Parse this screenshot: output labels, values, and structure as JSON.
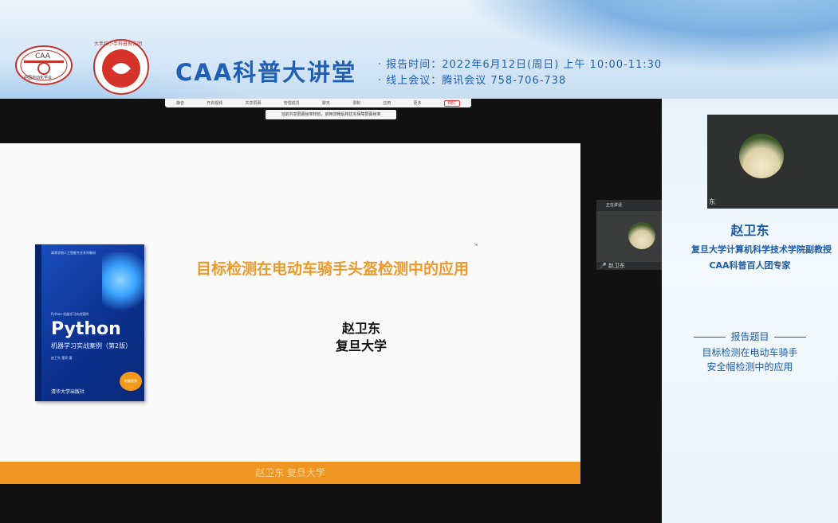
{
  "banner": {
    "brand": "CAA科普大讲堂",
    "time_line": "· 报告时间：2022年6月12日(周日) 上午 10:00-11:30",
    "meeting_line": "· 线上会议：腾讯会议 758-706-738",
    "logo1_text": "CAA",
    "logo1_sub": "中国自动化学会",
    "logo2_text": "大手拉小手科普报告团",
    "accent": "#1f5fb4"
  },
  "toolbar": {
    "items": [
      "静音",
      "开启视频",
      "共享屏幕",
      "管理成员",
      "聊天",
      "录制",
      "应用",
      "更多"
    ],
    "recording": "REC"
  },
  "notice": "当前共享屏幕帧率较低，启用流畅后将优先保障屏幕帧率",
  "slide": {
    "title": "目标检测在电动车骑手头盔检测中的应用",
    "author": "赵卫东",
    "affiliation": "复旦大学",
    "footer": "赵卫东 复旦大学",
    "book_title": "Python",
    "book_subtitle": "机器学习实战案例（第2版）",
    "book_tag": "Python 机器学习实战案例",
    "book_series": "高等学校人工智能专业系列教材",
    "book_authors": "赵卫东 董亮 著",
    "book_badge": "附赠视频",
    "book_publisher": "清华大学出版社"
  },
  "participant": {
    "status": "正在讲话",
    "name": "赵卫东"
  },
  "right_panel": {
    "video_tag": "东",
    "speaker_name": "赵卫东",
    "speaker_title": "复旦大学计算机科学技术学院副教授",
    "speaker_role": "CAA科普百人团专家",
    "topic_heading": "报告题目",
    "topic_line1": "目标检测在电动车骑手",
    "topic_line2": "安全帽检测中的应用"
  }
}
